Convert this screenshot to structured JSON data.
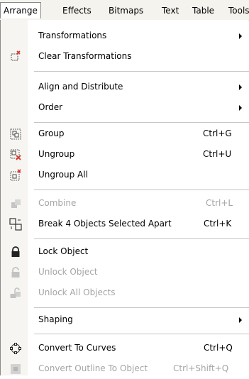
{
  "menubar": {
    "items": [
      {
        "label": "Arrange"
      },
      {
        "label": "Effects"
      },
      {
        "label": "Bitmaps"
      },
      {
        "label": "Text"
      },
      {
        "label": "Table"
      },
      {
        "label": "Tools"
      }
    ]
  },
  "menu": {
    "transformations": {
      "label": "Transformations"
    },
    "clear_transformations": {
      "label": "Clear Transformations"
    },
    "align_distribute": {
      "label": "Align and Distribute"
    },
    "order": {
      "label": "Order"
    },
    "group": {
      "label": "Group",
      "shortcut": "Ctrl+G"
    },
    "ungroup": {
      "label": "Ungroup",
      "shortcut": "Ctrl+U"
    },
    "ungroup_all": {
      "label": "Ungroup All"
    },
    "combine": {
      "label": "Combine",
      "shortcut": "Ctrl+L"
    },
    "break_apart": {
      "label": "Break 4 Objects Selected Apart",
      "shortcut": "Ctrl+K"
    },
    "lock_object": {
      "label": "Lock Object"
    },
    "unlock_object": {
      "label": "Unlock Object"
    },
    "unlock_all": {
      "label": "Unlock All Objects"
    },
    "shaping": {
      "label": "Shaping"
    },
    "convert_to_curves": {
      "label": "Convert To Curves",
      "shortcut": "Ctrl+Q"
    },
    "convert_outline": {
      "label": "Convert Outline To Object",
      "shortcut": "Ctrl+Shift+Q"
    }
  },
  "colors": {
    "accent_red": "#d8322a",
    "disabled": "#a4a4a4"
  }
}
